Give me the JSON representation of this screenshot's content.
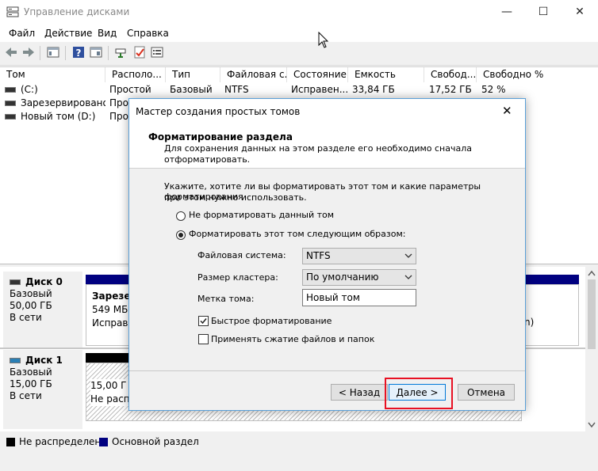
{
  "window": {
    "title": "Управление дисками",
    "minimize": "—",
    "maximize": "☐",
    "close": "✕"
  },
  "menu": [
    "Файл",
    "Действие",
    "Вид",
    "Справка"
  ],
  "columns": [
    "Том",
    "Располо...",
    "Тип",
    "Файловая с...",
    "Состояние",
    "Емкость",
    "Свобод...",
    "Свободно %"
  ],
  "volumes": [
    {
      "name": "(C:)",
      "layout": "Простой",
      "type": "Базовый",
      "fs": "NTFS",
      "status": "Исправен...",
      "capacity": "33,84 ГБ",
      "free": "17,52 ГБ",
      "free_pct": "52 %"
    },
    {
      "name": "Зарезервировано...",
      "layout": "Прос"
    },
    {
      "name": "Новый том (D:)",
      "layout": "Про"
    }
  ],
  "disks": [
    {
      "name": "Диск 0",
      "type": "Базовый",
      "size": "50,00 ГБ",
      "status": "В сети",
      "partition": {
        "title": "Зарезер",
        "size": "549 МБ N",
        "status": "Исправе"
      },
      "tail": "n)"
    },
    {
      "name": "Диск 1",
      "type": "Базовый",
      "size": "15,00 ГБ",
      "status": "В сети",
      "partition": {
        "size": "15,00 Г",
        "status": "Не распр"
      }
    }
  ],
  "legend": {
    "unallocated": "Не распределена",
    "primary": "Основной раздел"
  },
  "colors": {
    "unallocated": "#000000",
    "primary": "#000080",
    "highlight": "#e81123",
    "accent": "#0078d7"
  },
  "dialog": {
    "title": "Мастер создания простых томов",
    "heading": "Форматирование раздела",
    "subheading_line1": "Для сохранения данных на этом разделе его необходимо сначала",
    "subheading_line2": "отформатировать.",
    "instruction_line1": "Укажите, хотите ли вы форматировать этот том и какие параметры форматирования",
    "instruction_line2": "при этом нужно использовать.",
    "radio_no_format": "Не форматировать данный том",
    "radio_format": "Форматировать этот том следующим образом:",
    "fs_label": "Файловая система:",
    "fs_value": "NTFS",
    "cluster_label": "Размер кластера:",
    "cluster_value": "По умолчанию",
    "volume_label": "Метка тома:",
    "volume_value": "Новый том",
    "quick_format": "Быстрое форматирование",
    "compression": "Применять сжатие файлов и папок",
    "back": "< Назад",
    "next": "Далее >",
    "cancel": "Отмена",
    "close": "✕"
  }
}
